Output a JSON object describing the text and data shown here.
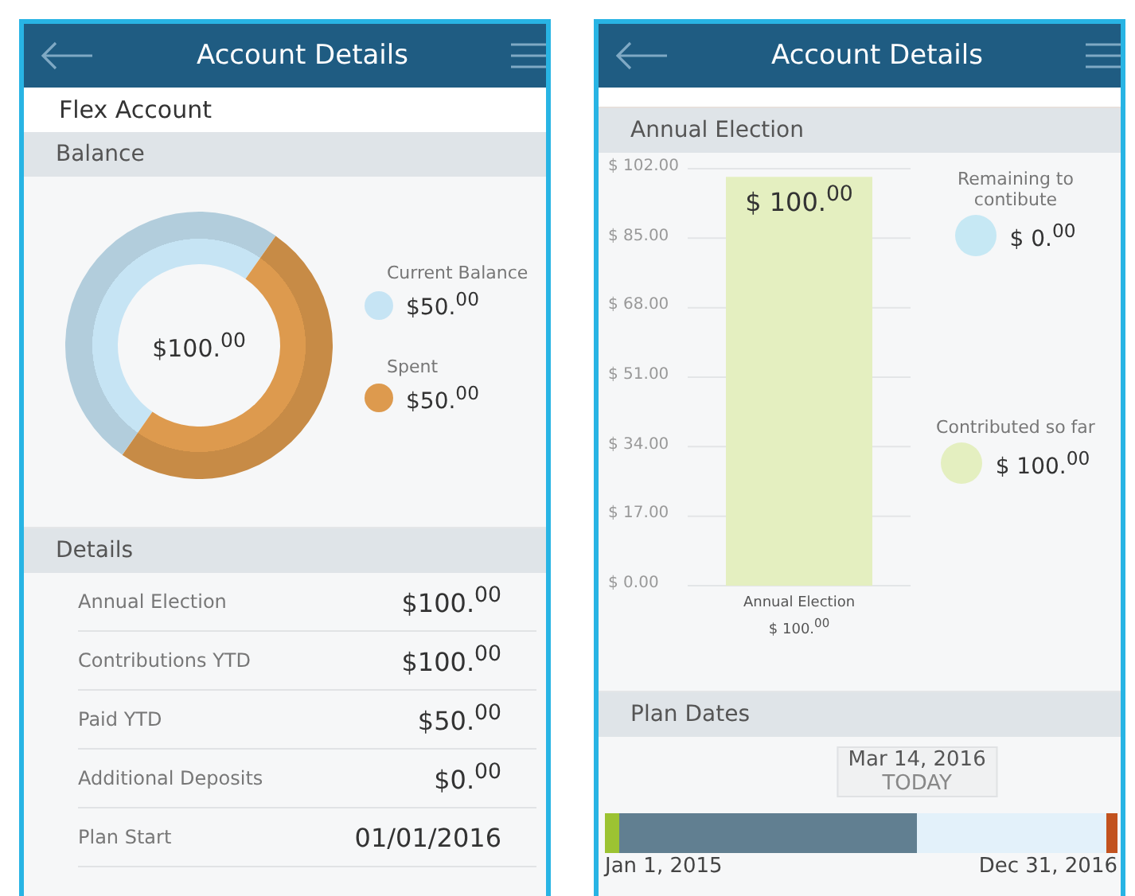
{
  "left_screen": {
    "header": {
      "title": "Account Details"
    },
    "account_name": "Flex Account",
    "balance": {
      "title": "Balance",
      "center_amount": "$100.$^{00}$",
      "chart_data": {
        "type": "donut",
        "categories": [
          "Current Balance",
          "Spent"
        ],
        "values": [
          50,
          50
        ]
      },
      "legend": [
        {
          "amount": "$50.$^{00}$",
          "color": "#c6e4f4"
        },
        {
          "amount": "$50.$^{00}$",
          "color": "#dd9a4e"
        }
      ]
    },
    "details": {
      "title": "Details",
      "rows": [
        {
          "label": "Annual Election",
          "value": "$100.$^{00}$"
        },
        {
          "label": "Contributions YTD",
          "value": "$100.$^{00}$"
        },
        {
          "label": "Paid YTD",
          "value": "$50.$^{00}$"
        },
        {
          "label": "Additional Deposits",
          "value": "$0.$^{00}$"
        },
        {
          "label": "Plan Start",
          "value": "01/01/2016"
        }
      ]
    }
  },
  "right_screen": {
    "header": {
      "title": "Account Details"
    },
    "annual_election": {
      "title": "Annual Election",
      "chart_data": {
        "type": "bar",
        "categories": [
          "Annual Election"
        ],
        "values": [
          100
        ],
        "ylim": [
          0,
          102
        ],
        "yticks": [
          {
            "value": 102,
            "label": "$ 102.00"
          },
          {
            "value": 85,
            "label": "$ 85.00"
          },
          {
            "value": 68,
            "label": "$ 68.00"
          },
          {
            "value": 51,
            "label": "$ 51.00"
          },
          {
            "value": 34,
            "label": "$ 34.00"
          },
          {
            "value": 17,
            "label": "$ 17.00"
          },
          {
            "value": 0,
            "label": "$ 0.00"
          }
        ],
        "grid": true,
        "value_labels": [
          "$ 100.$^{00}$"
        ]
      },
      "category_amount": "$ 100.$^{00}$",
      "legend": [
        {
          "label": "Remaining to contibute",
          "amount": "$ 0.$^{00}$",
          "color": "#c6e8f4"
        },
        {
          "label": "Contributed so far",
          "amount": "$ 100.$^{00}$",
          "color": "#e4efc0"
        }
      ]
    },
    "plan_dates": {
      "title": "Plan Dates",
      "today_date": "Mar 14, 2016",
      "today_label": "TODAY",
      "level": 0.61,
      "start_label": "Jan 1, 2015",
      "end_label": "Dec 31, 2016"
    }
  }
}
